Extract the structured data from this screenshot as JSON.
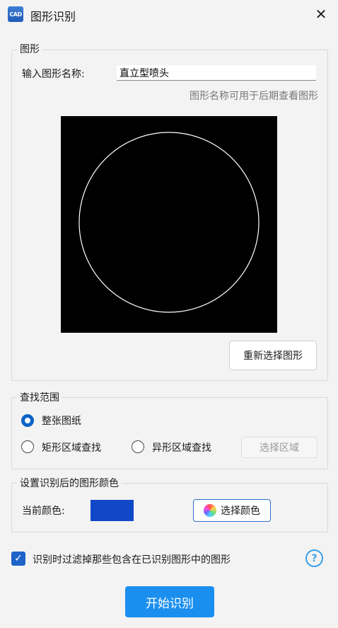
{
  "window": {
    "title": "图形识别",
    "app_icon_text": "CAD",
    "close_icon": "close-icon"
  },
  "shape_group": {
    "legend": "图形",
    "name_label": "输入图形名称:",
    "name_value": "直立型喷头",
    "hint": "图形名称可用于后期查看图形",
    "reselect_button": "重新选择图形",
    "preview": {
      "shape": "circle",
      "background": "#000000",
      "stroke": "#ffffff"
    }
  },
  "search_group": {
    "legend": "查找范围",
    "options": [
      {
        "label": "整张图纸",
        "checked": true
      },
      {
        "label": "矩形区域查找",
        "checked": false
      },
      {
        "label": "异形区域查找",
        "checked": false
      }
    ],
    "select_area_button": "选择区域"
  },
  "color_group": {
    "legend": "设置识别后的图形颜色",
    "current_label": "当前颜色:",
    "current_color": "#1048c8",
    "select_color_button": "选择颜色"
  },
  "filter": {
    "checked": true,
    "label": "识别时过滤掉那些包含在已识别图形中的图形",
    "help_icon": "?"
  },
  "start_button": "开始识别",
  "colors": {
    "accent": "#1b8ff0",
    "radio": "#0a64c8"
  }
}
